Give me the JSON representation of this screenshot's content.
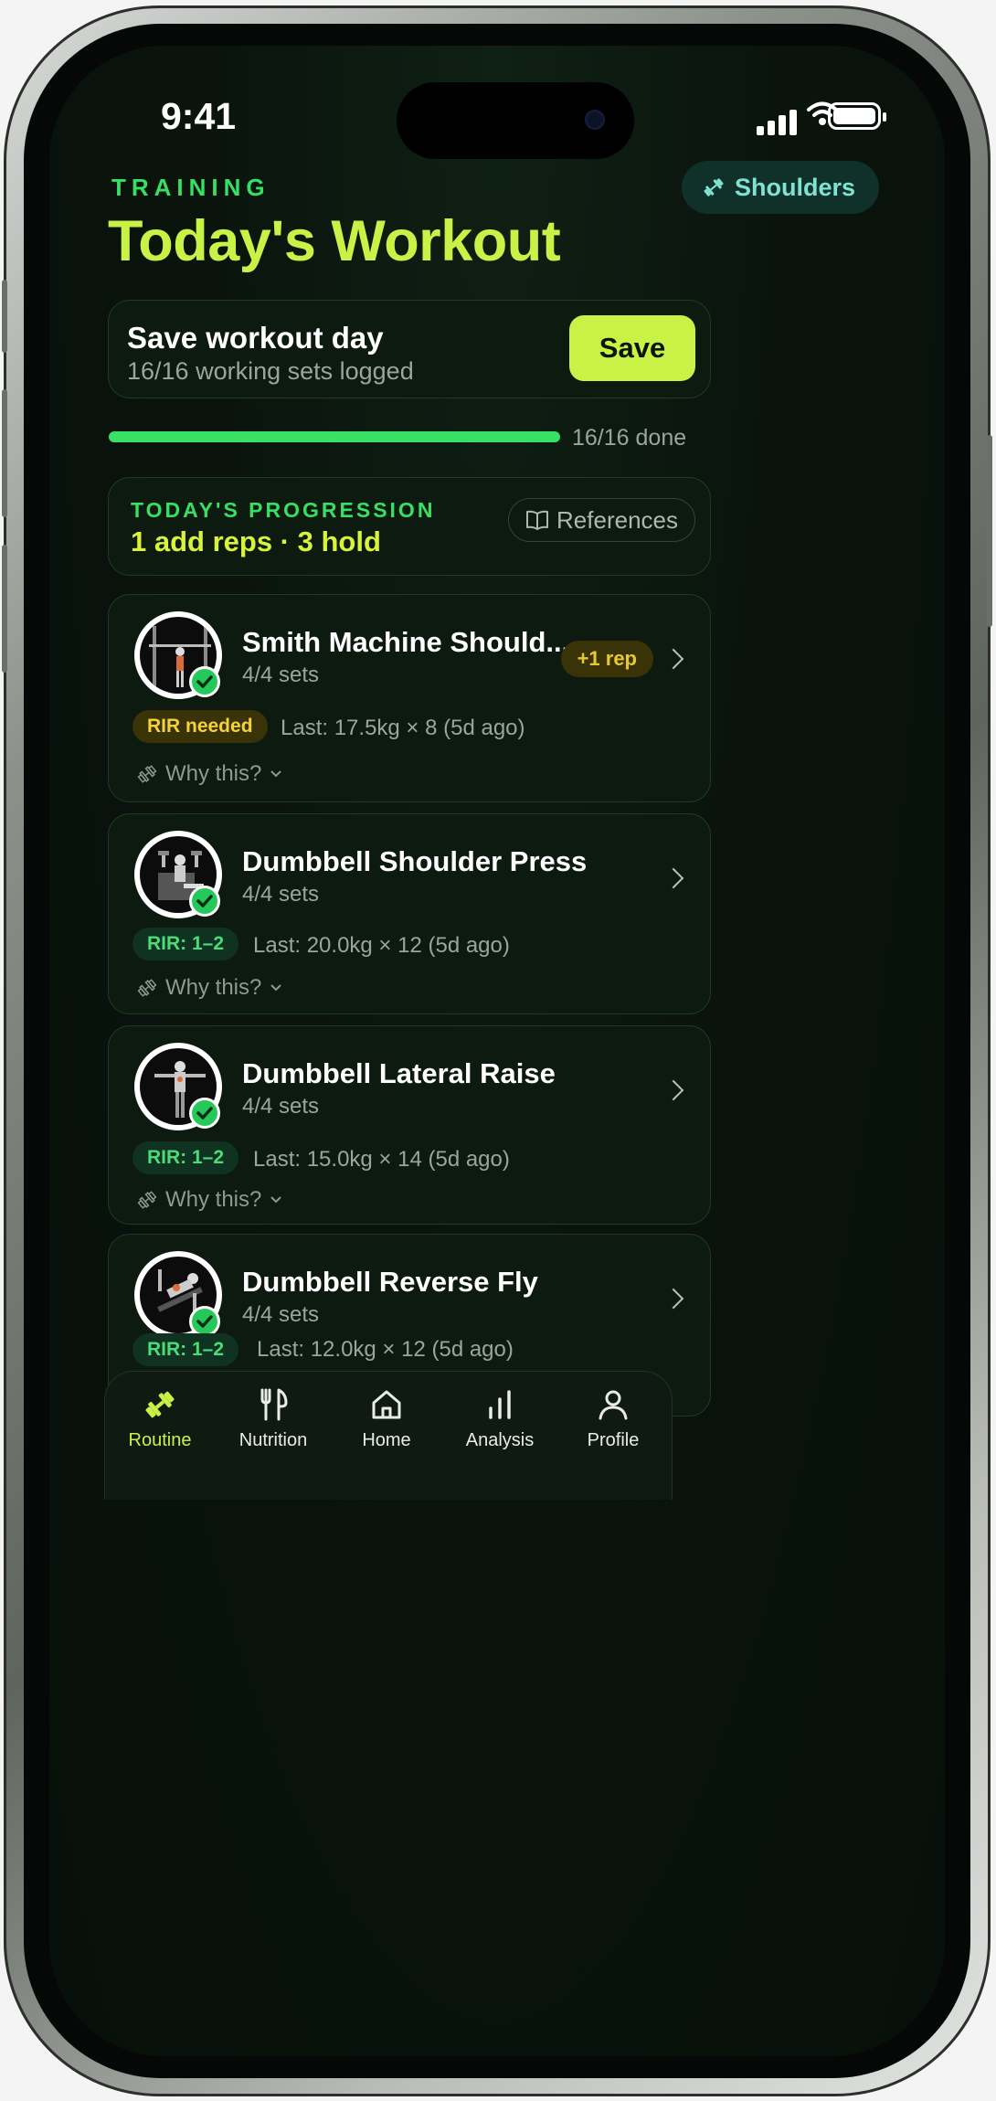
{
  "status_bar": {
    "time": "9:41"
  },
  "header": {
    "overline": "TRAINING",
    "title": "Today's Workout",
    "muscle_chip": "Shoulders"
  },
  "save_card": {
    "title": "Save workout day",
    "subtitle": "16/16 working sets logged",
    "button_label": "Save"
  },
  "progress": {
    "fraction": 1.0,
    "label": "16/16 done"
  },
  "progression": {
    "overline": "TODAY'S PROGRESSION",
    "summary": "1 add reps · 3 hold",
    "references_label": "References"
  },
  "exercises": [
    {
      "name": "Smith Machine Should...",
      "sets": "4/4 sets",
      "badge": "RIR needed",
      "badge_kind": "warn",
      "last": "Last: 17.5kg × 8 (5d ago)",
      "why": "Why this?",
      "tag": "+1 rep"
    },
    {
      "name": "Dumbbell Shoulder Press",
      "sets": "4/4 sets",
      "badge": "RIR: 1–2",
      "badge_kind": "ok",
      "last": "Last: 20.0kg × 12 (5d ago)",
      "why": "Why this?"
    },
    {
      "name": "Dumbbell Lateral Raise",
      "sets": "4/4 sets",
      "badge": "RIR: 1–2",
      "badge_kind": "ok",
      "last": "Last: 15.0kg × 14 (5d ago)",
      "why": "Why this?"
    },
    {
      "name": "Dumbbell Reverse Fly",
      "sets": "4/4 sets",
      "badge": "RIR: 1–2",
      "badge_kind": "ok",
      "last": "Last: 12.0kg × 12 (5d ago)"
    }
  ],
  "tabbar": {
    "items": [
      {
        "label": "Routine",
        "icon": "routine-icon",
        "active": true
      },
      {
        "label": "Nutrition",
        "icon": "fork-knife-icon"
      },
      {
        "label": "Home",
        "icon": "home-icon"
      },
      {
        "label": "Analysis",
        "icon": "bar-chart-icon"
      },
      {
        "label": "Profile",
        "icon": "person-icon"
      }
    ]
  },
  "colors": {
    "accent": "#c9f247",
    "green": "#38e066",
    "background": "#0a140d"
  }
}
